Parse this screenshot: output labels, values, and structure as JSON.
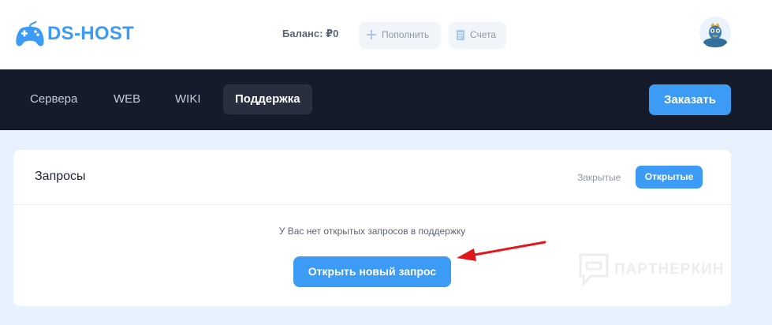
{
  "header": {
    "logo_text": "DS-HOST",
    "balance": "Баланс: ₽0",
    "topup_label": "Пополнить",
    "bills_label": "Счета"
  },
  "nav": {
    "items": [
      {
        "label": "Сервера"
      },
      {
        "label": "WEB"
      },
      {
        "label": "WIKI"
      },
      {
        "label": "Поддержка",
        "active": true
      }
    ],
    "order_label": "Заказать"
  },
  "requests": {
    "title": "Запросы",
    "filter_closed": "Закрытые",
    "filter_open": "Открытые",
    "empty_text": "У Вас нет открытых запросов в поддержку",
    "open_new_label": "Открыть новый запрос"
  },
  "watermark": {
    "text": "ПАРТНЕРКИН"
  },
  "colors": {
    "accent": "#3b9bf5",
    "nav_bg": "#161b2c",
    "page_bg": "#e8f1fe",
    "annotation_arrow": "#e3161b"
  }
}
